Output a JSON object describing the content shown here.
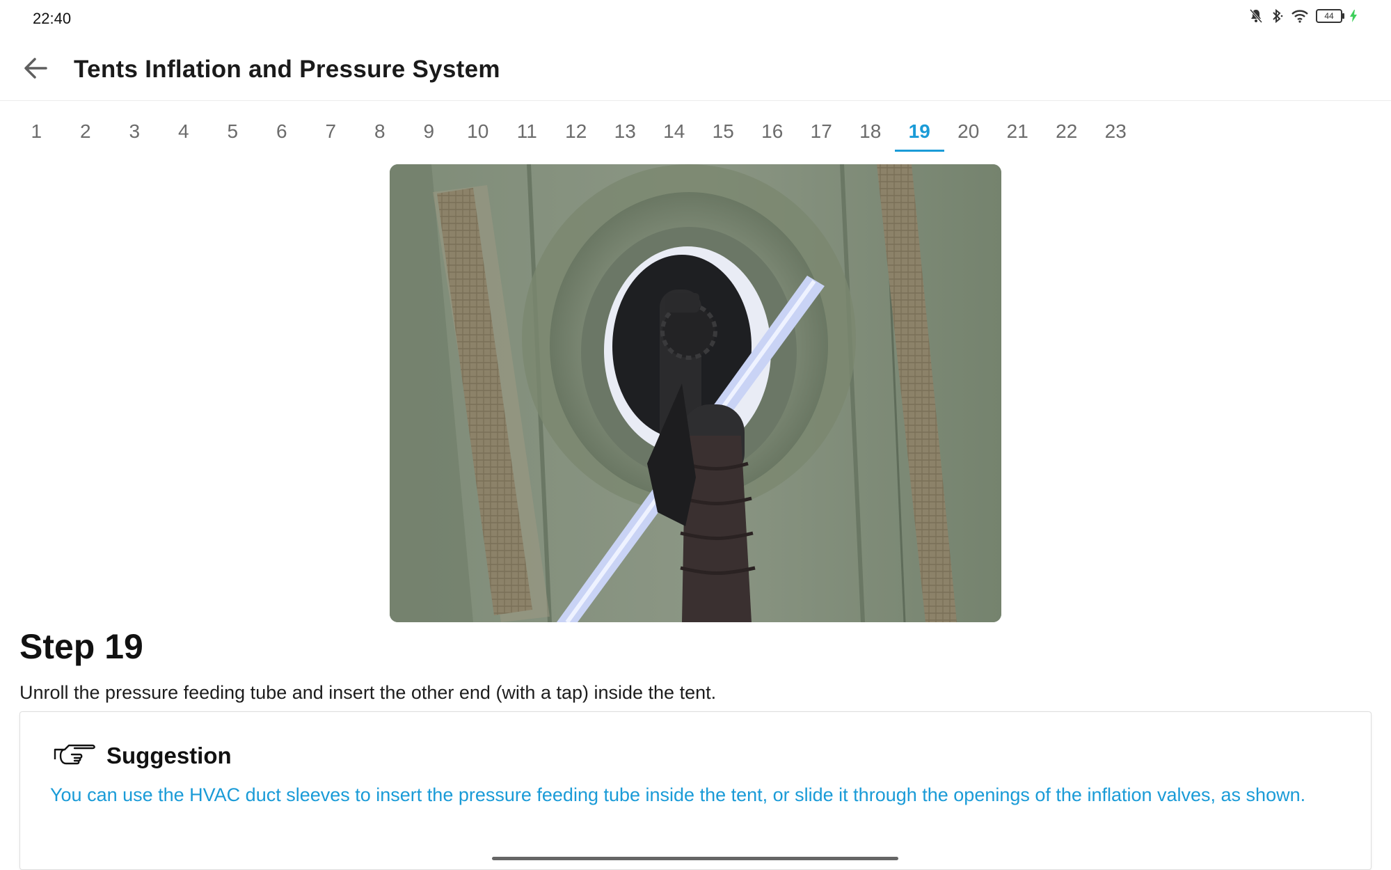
{
  "status_bar": {
    "time": "22:40",
    "battery_level": "44",
    "icons": [
      "bell-off-icon",
      "bluetooth-icon",
      "wifi-icon",
      "battery-icon",
      "charging-bolt-icon"
    ]
  },
  "header": {
    "back_icon": "arrow-left-icon",
    "title": "Tents Inflation and Pressure System"
  },
  "step_tabs": {
    "items": [
      "1",
      "2",
      "3",
      "4",
      "5",
      "6",
      "7",
      "8",
      "9",
      "10",
      "11",
      "12",
      "13",
      "14",
      "15",
      "16",
      "17",
      "18",
      "19",
      "20",
      "21",
      "22",
      "23"
    ],
    "selected": "19"
  },
  "step": {
    "title": "Step 19",
    "description": "Unroll the pressure feeding tube and insert the other end (with a tap) inside the tent."
  },
  "suggestion": {
    "icon": "pointing-hand-icon",
    "title": "Suggestion",
    "text": "You can use the HVAC duct sleeves to insert the pressure feeding tube inside the tent, or slide it through the openings of the inflation valves, as shown."
  },
  "colors": {
    "accent": "#1a9bd7",
    "tent_fabric": "#7c8a74"
  }
}
